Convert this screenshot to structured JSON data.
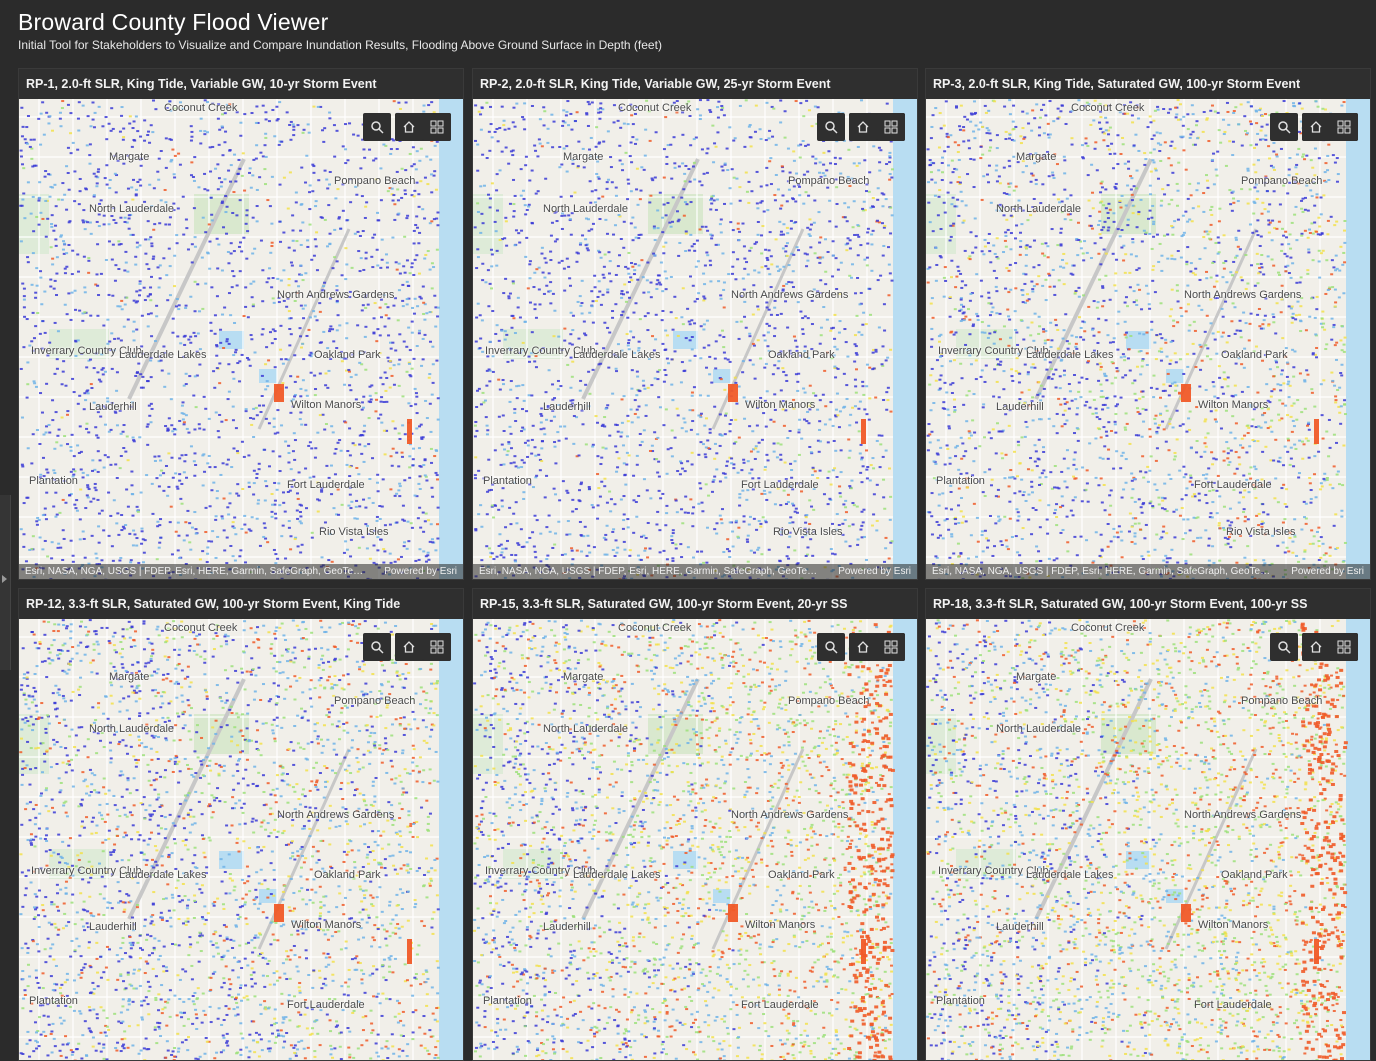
{
  "app": {
    "title": "Broward County Flood Viewer",
    "subtitle": "Initial Tool for Stakeholders to Visualize and Compare Inundation Results, Flooding Above Ground Surface in Depth (feet)"
  },
  "attribution": {
    "sources": "Esri, NASA, NGA, USGS | FDEP, Esri, HERE, Garmin, SafeGraph, GeoTec...",
    "powered": "Powered by Esri"
  },
  "map_labels": {
    "coconut_creek": "Coconut Creek",
    "margate": "Margate",
    "pompano": "Pompano Beach",
    "north_lauderdale": "North Lauderdale",
    "north_andrews": "North Andrews Gardens",
    "inverrary": "Inverrary Country Club",
    "lauderdale_lakes": "Lauderdale Lakes",
    "oakland_park": "Oakland Park",
    "lauderhill": "Lauderhill",
    "wilton_manors": "Wilton Manors",
    "plantation": "Plantation",
    "fort_lauderdale": "Fort Lauderdale",
    "rio_vista": "Rio Vista Isles"
  },
  "colors": {
    "shallow": "#3a3ad6",
    "low": "#6fb3e8",
    "medium": "#9ce07a",
    "high": "#f2e04a",
    "deep": "#f05a28",
    "water": "#b8ddf2",
    "land": "#f1efe9"
  },
  "panels": [
    {
      "title": "RP-1, 2.0-ft SLR, King Tide, Variable GW, 10-yr Storm Event",
      "intensity": 0.15
    },
    {
      "title": "RP-2, 2.0-ft SLR, King Tide, Variable GW, 25-yr Storm Event",
      "intensity": 0.2
    },
    {
      "title": "RP-3, 2.0-ft SLR, King Tide, Saturated GW, 100-yr Storm Event",
      "intensity": 0.5
    },
    {
      "title": "RP-12, 3.3-ft SLR, Saturated GW, 100-yr Storm Event, King Tide",
      "intensity": 0.6
    },
    {
      "title": "RP-15, 3.3-ft SLR, Saturated GW, 100-yr Storm Event, 20-yr SS",
      "intensity": 0.85
    },
    {
      "title": "RP-18, 3.3-ft SLR, Saturated GW, 100-yr Storm Event, 100-yr SS",
      "intensity": 0.95
    }
  ]
}
